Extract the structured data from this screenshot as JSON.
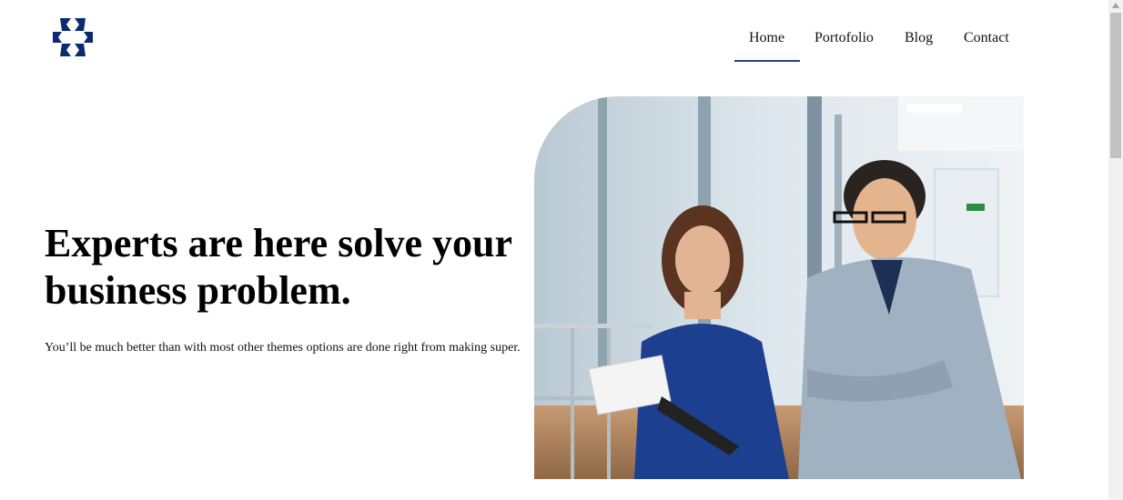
{
  "brand": {
    "logo_icon": "four-arrows-logo-icon",
    "primary_color": "#0b2a73"
  },
  "nav": {
    "items": [
      "Home",
      "Portofolio",
      "Blog",
      "Contact"
    ],
    "active_index": 0,
    "accent_color": "#2b3f8f"
  },
  "hero": {
    "headline_line1": "Experts are here solve your",
    "headline_line2": "business problem.",
    "subtext": "You’ll be much better than with most other themes options are done right from making super.",
    "image_icon": "office-team-photo"
  }
}
